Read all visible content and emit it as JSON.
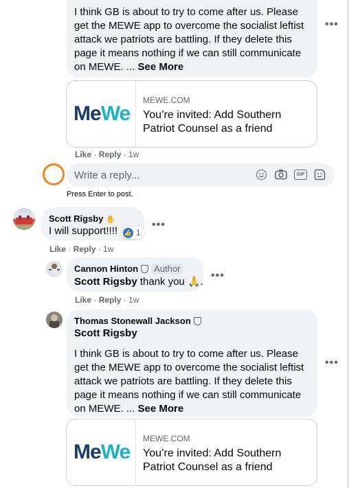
{
  "comment1": {
    "lines": [
      "I think GB is about to try to come after us. Please",
      "get the MEWE app to overcome the socialist leftist",
      "attack we patriots are battling. If they delete this",
      "page it means nothing if we can still communicate",
      "on MEWE. ... "
    ],
    "see_more": "See More",
    "card": {
      "domain": "MEWE.COM",
      "title_line1": "You’re invited: Add Southern",
      "title_line2": "Patriot Counsel as a friend",
      "logo": "MeWe"
    },
    "like": "Like",
    "reply": "Reply",
    "time": "1w"
  },
  "reply_box": {
    "placeholder": "Write a reply...",
    "hint": "Press Enter to post."
  },
  "comment2": {
    "author": "Scott Rigsby",
    "text": "I will support!!!!",
    "reaction_count": "1",
    "like": "Like",
    "reply": "Reply",
    "time": "1w"
  },
  "comment3": {
    "author": "Cannon Hinton",
    "badge": "Author",
    "mention": "Scott Rigsby",
    "text": " thank you 🙏.",
    "like": "Like",
    "reply": "Reply",
    "time": "1w"
  },
  "comment4": {
    "author": "Thomas Stonewall Jackson",
    "mention": "Scott Rigsby",
    "lines": [
      "I think GB is about to try to come after us. Please",
      "get the MEWE app to overcome the socialist leftist",
      "attack we patriots are battling. If they delete this",
      "page it means nothing if we can still communicate",
      "on MEWE. ... "
    ],
    "see_more": "See More",
    "card": {
      "domain": "MEWE.COM",
      "title_line1": "You’re invited: Add Southern",
      "title_line2": "Patriot Counsel as a friend",
      "logo": "MeWe"
    }
  },
  "colors": {
    "mewe_blue": "#1b3d6d",
    "mewe_teal": "#18b4c5",
    "like_blue": "#1877f2",
    "highlight_orange": "#f7821b"
  }
}
